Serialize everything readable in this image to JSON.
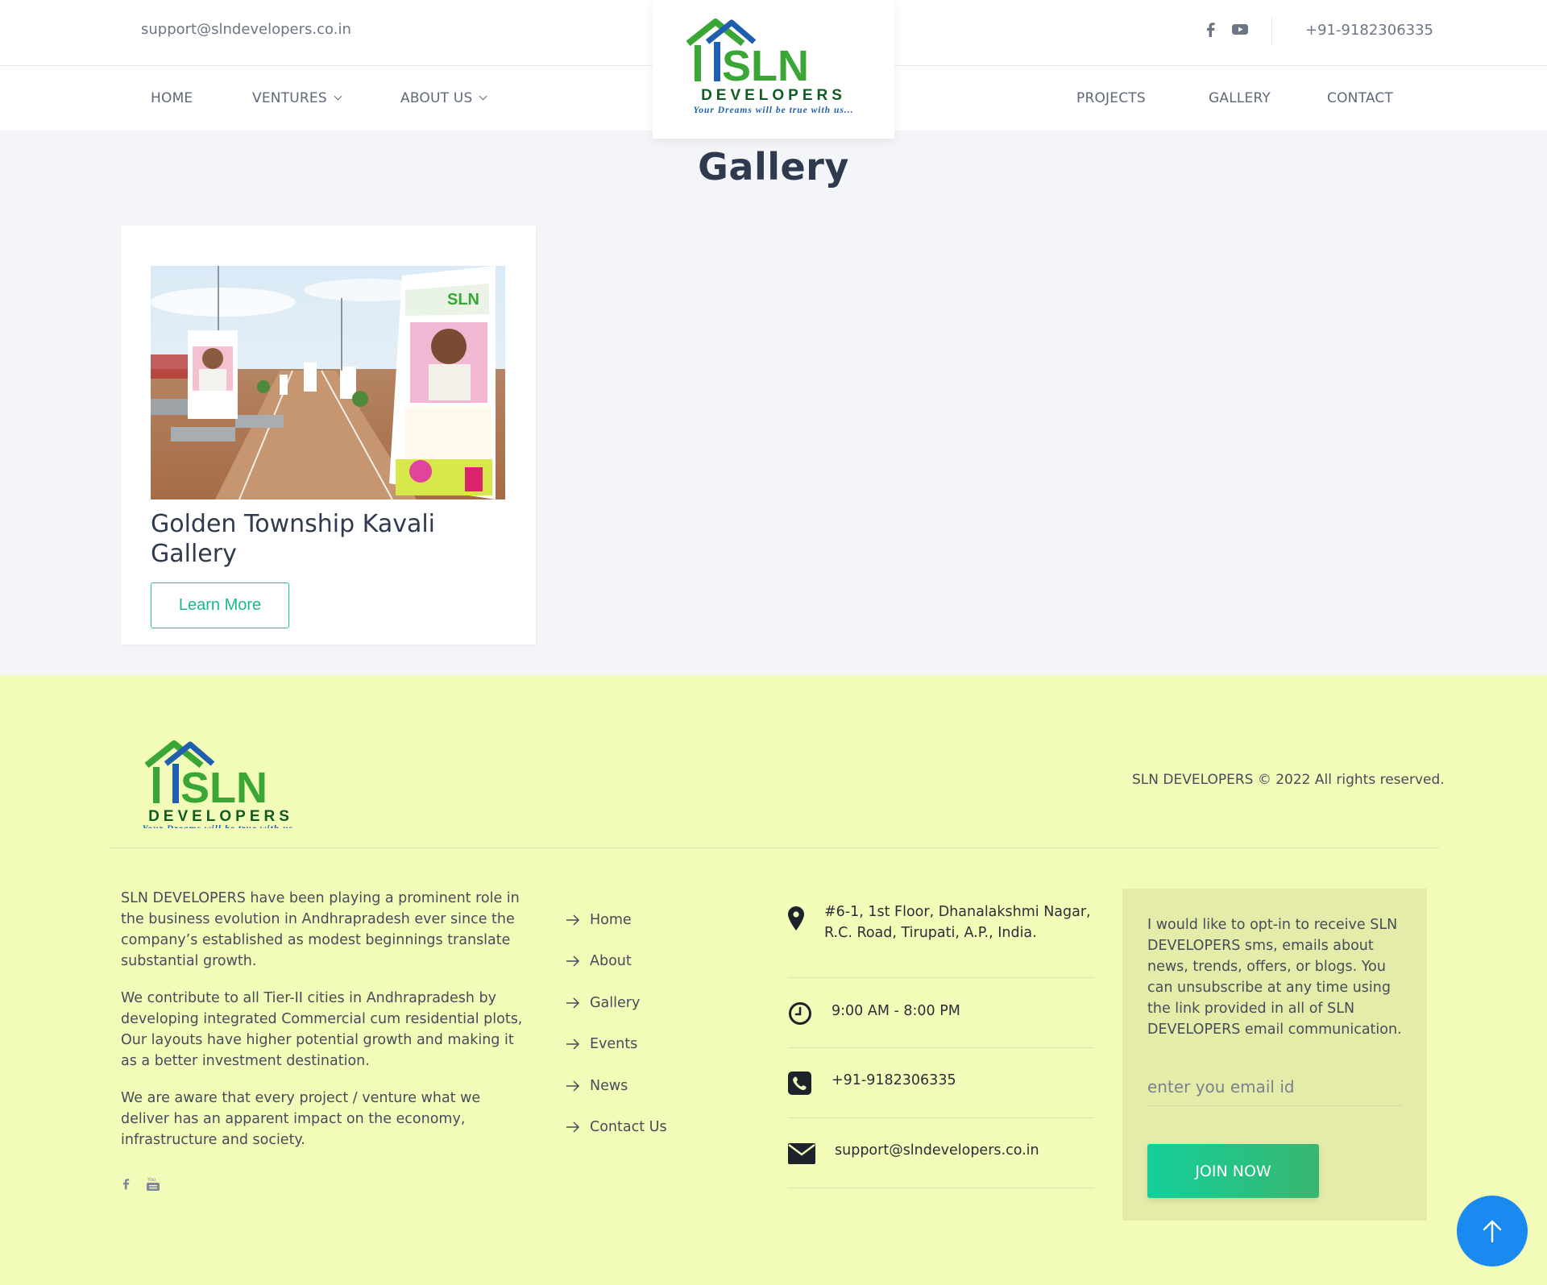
{
  "topbar": {
    "email": "support@slndevelopers.co.in",
    "phone": "+91-9182306335",
    "social": [
      "facebook-icon",
      "youtube-icon"
    ]
  },
  "logo": {
    "brand": "SLN",
    "sub": "DEVELOPERS",
    "tagline": "Your Dreams will be true with us...",
    "colors": {
      "green": "#3aa635",
      "blue": "#1f5fae",
      "dark_green": "#0f5b22"
    }
  },
  "nav": {
    "home": "HOME",
    "ventures": "VENTURES",
    "about": "ABOUT US",
    "projects": "PROJECTS",
    "gallery": "GALLERY",
    "contact": "CONTACT"
  },
  "main": {
    "title": "Gallery",
    "card": {
      "title": "Golden Township Kavali Gallery",
      "button": "Learn More"
    }
  },
  "footer": {
    "copyright": "SLN DEVELOPERS © 2022 All rights reserved.",
    "about": [
      "SLN DEVELOPERS have been playing a prominent role in the business evolution in Andhrapradesh ever since the company’s established as modest beginnings translate substantial growth.",
      "We contribute to all Tier-II cities in Andhrapradesh by developing integrated Commercial cum residential plots, Our layouts have higher potential growth and making it as a better investment destination.",
      "We are aware that every project / venture what we deliver has an apparent impact on the economy, infrastructure and society."
    ],
    "links": [
      "Home",
      "About",
      "Gallery",
      "Events",
      "News",
      "Contact Us"
    ],
    "contact": {
      "address_line1": "#6-1, 1st Floor, Dhanalakshmi Nagar,",
      "address_line2": "R.C. Road, Tirupati, A.P., India.",
      "hours": "9:00 AM - 8:00 PM",
      "phone": "+91-9182306335",
      "email": "support@slndevelopers.co.in"
    },
    "newsletter": {
      "text": "I would like to opt-in to receive SLN DEVELOPERS sms, emails about news, trends, offers, or blogs. You can unsubscribe at any time using the link provided in all of SLN DEVELOPERS email communication.",
      "placeholder": "enter you email id",
      "button": "JOIN NOW"
    }
  },
  "accent": {
    "teal": "#17c9a0",
    "blue_button": "#1b8af0",
    "footer_bg": "#f2fbb8"
  }
}
